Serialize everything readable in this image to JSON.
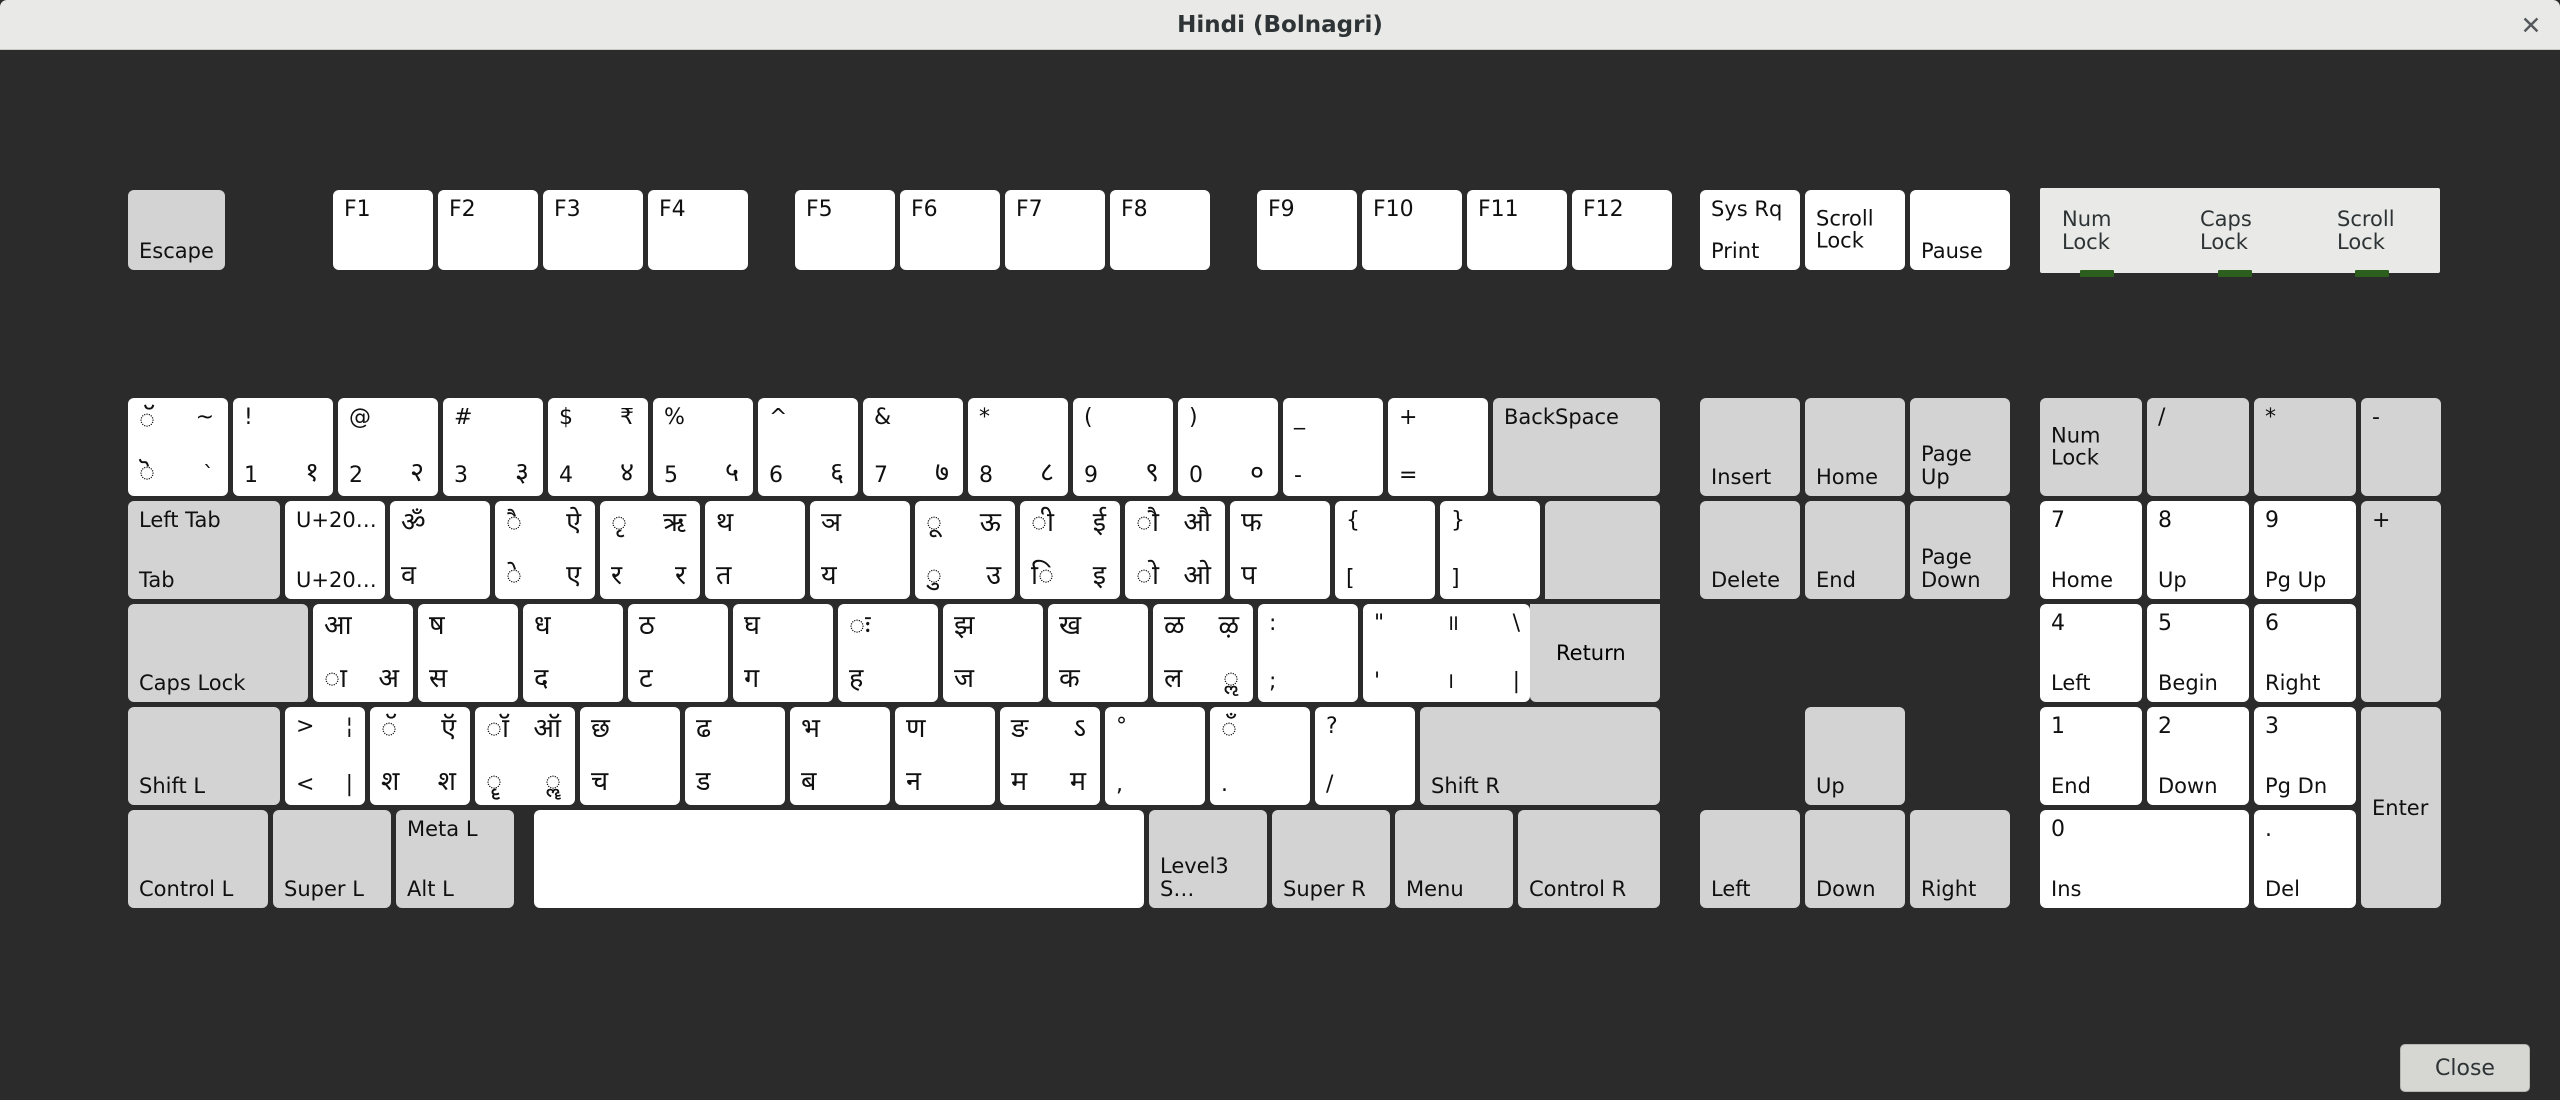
{
  "window": {
    "title": "Hindi (Bolnagri)",
    "close_icon": "close-icon",
    "close_button_label": "Close"
  },
  "indicators": [
    {
      "name": "num-lock",
      "label": "Num\nLock",
      "led_color": "#2c5f1e",
      "on": true
    },
    {
      "name": "caps-lock",
      "label": "Caps\nLock",
      "led_color": "#2c5f1e",
      "on": true
    },
    {
      "name": "scroll-lock",
      "label": "Scroll\nLock",
      "led_color": "#2c5f1e",
      "on": true
    }
  ],
  "keys": {
    "escape": "Escape",
    "f1": "F1",
    "f2": "F2",
    "f3": "F3",
    "f4": "F4",
    "f5": "F5",
    "f6": "F6",
    "f7": "F7",
    "f8": "F8",
    "f9": "F9",
    "f10": "F10",
    "f11": "F11",
    "f12": "F12",
    "sysrq_top": "Sys Rq",
    "sysrq_bottom": "Print",
    "scrolllock": "Scroll\nLock",
    "pause": "Pause",
    "grave_tl": "◌ॅ",
    "grave_tr": "~",
    "grave_bl": "◌ॆ",
    "grave_br": "`",
    "d1_tl": "!",
    "d1_tr": "",
    "d1_bl": "1",
    "d1_br": "१",
    "d2_tl": "@",
    "d2_tr": "",
    "d2_bl": "2",
    "d2_br": "२",
    "d3_tl": "#",
    "d3_tr": "",
    "d3_bl": "3",
    "d3_br": "३",
    "d4_tl": "$",
    "d4_tr": "₹",
    "d4_bl": "4",
    "d4_br": "४",
    "d5_tl": "%",
    "d5_tr": "",
    "d5_bl": "5",
    "d5_br": "५",
    "d6_tl": "^",
    "d6_tr": "",
    "d6_bl": "6",
    "d6_br": "६",
    "d7_tl": "&",
    "d7_tr": "",
    "d7_bl": "7",
    "d7_br": "७",
    "d8_tl": "*",
    "d8_tr": "",
    "d8_bl": "8",
    "d8_br": "८",
    "d9_tl": "(",
    "d9_tr": "",
    "d9_bl": "9",
    "d9_br": "९",
    "d0_tl": ")",
    "d0_tr": "",
    "d0_bl": "0",
    "d0_br": "०",
    "minus_tl": "_",
    "minus_bl": "-",
    "equal_tl": "+",
    "equal_bl": "=",
    "backspace": "BackSpace",
    "tab_top": "Left Tab",
    "tab_bottom": "Tab",
    "q_tl": "U+20…",
    "q_bl": "U+20…",
    "w_tl": "ॐ",
    "w_bl": "व",
    "e_tl": "◌ै",
    "e_tr": "ऐ",
    "e_bl": "◌े",
    "e_br": "ए",
    "r_tl": "◌ृ",
    "r_tr": "ऋ",
    "r_bl": "र",
    "r_br": "र",
    "t_tl": "थ",
    "t_bl": "त",
    "y_tl": "ञ",
    "y_bl": "य",
    "u_tl": "◌ू",
    "u_tr": "ऊ",
    "u_bl": "◌ु",
    "u_br": "उ",
    "i_tl": "◌ी",
    "i_tr": "ई",
    "i_bl": "◌ि",
    "i_br": "इ",
    "o_tl": "◌ौ",
    "o_tr": "औ",
    "o_bl": "◌ो",
    "o_br": "ओ",
    "p_tl": "फ",
    "p_bl": "प",
    "lbracket_tl": "{",
    "lbracket_bl": "[",
    "rbracket_tl": "}",
    "rbracket_bl": "]",
    "return": "Return",
    "capslock": "Caps Lock",
    "a_tl": "आ",
    "a_bl": "◌ा",
    "a_br": "अ",
    "s_tl": "ष",
    "s_bl": "स",
    "d_tl": "ध",
    "d_bl": "द",
    "f_tl": "ठ",
    "f_bl": "ट",
    "g_tl": "घ",
    "g_bl": "ग",
    "h_tl": "◌ः",
    "h_bl": "ह",
    "j_tl": "झ",
    "j_bl": "ज",
    "k_tl": "ख",
    "k_bl": "क",
    "l_tl": "ळ",
    "l_tr": "ऴ",
    "l_bl": "ल",
    "l_br": "◌ॢ",
    "semicolon_tl": ":",
    "semicolon_bl": ";",
    "quote_tl": "\"",
    "quote_bl": "'",
    "backslash_tl": "॥",
    "backslash_tr": "\\",
    "backslash_bl": "।",
    "backslash_br": "|",
    "shiftl": "Shift L",
    "less_tl": ">",
    "less_tr": "¦",
    "less_bl": "<",
    "less_br": "|",
    "z_tl": "◌ॅ",
    "z_tr": "ऍ",
    "z_bl": "श",
    "z_br": "श",
    "x_tl": "◌ॉ",
    "x_tr": "ऑ",
    "x_bl": "◌ॄ",
    "x_br": "◌ॣ",
    "c_tl": "छ",
    "c_bl": "च",
    "v_tl": "ढ",
    "v_bl": "ड",
    "b_tl": "भ",
    "b_bl": "ब",
    "n_tl": "ण",
    "n_bl": "न",
    "m_tl": "ङ",
    "m_tr": "ऽ",
    "m_bl": "म",
    "m_br": "म",
    "comma_tl": "°",
    "comma_bl": ",",
    "period_tl": "◌ँ",
    "period_bl": ".",
    "slash_tl": "?",
    "slash_bl": "/",
    "shiftr": "Shift R",
    "controll": "Control L",
    "superl": "Super L",
    "meta_top": "Meta L",
    "meta_bottom": "Alt L",
    "space": "",
    "level3": "Level3 S…",
    "superr": "Super R",
    "menu": "Menu",
    "controlr": "Control R",
    "insert": "Insert",
    "home": "Home",
    "pageup": "Page\nUp",
    "delete": "Delete",
    "end": "End",
    "pagedown": "Page\nDown",
    "arrow_up": "Up",
    "arrow_left": "Left",
    "arrow_down": "Down",
    "arrow_right": "Right",
    "kp_numlock": "Num\nLock",
    "kp_divide": "/",
    "kp_multiply": "*",
    "kp_subtract": "-",
    "kp7_top": "7",
    "kp7_bottom": "Home",
    "kp8_top": "8",
    "kp8_bottom": "Up",
    "kp9_top": "9",
    "kp9_bottom": "Pg Up",
    "kp_add": "+",
    "kp4_top": "4",
    "kp4_bottom": "Left",
    "kp5_top": "5",
    "kp5_bottom": "Begin",
    "kp6_top": "6",
    "kp6_bottom": "Right",
    "kp1_top": "1",
    "kp1_bottom": "End",
    "kp2_top": "2",
    "kp2_bottom": "Down",
    "kp3_top": "3",
    "kp3_bottom": "Pg Dn",
    "kp0_top": "0",
    "kp0_bottom": "Ins",
    "kpdot_top": ".",
    "kpdot_bottom": "Del",
    "kp_enter": "Enter"
  }
}
